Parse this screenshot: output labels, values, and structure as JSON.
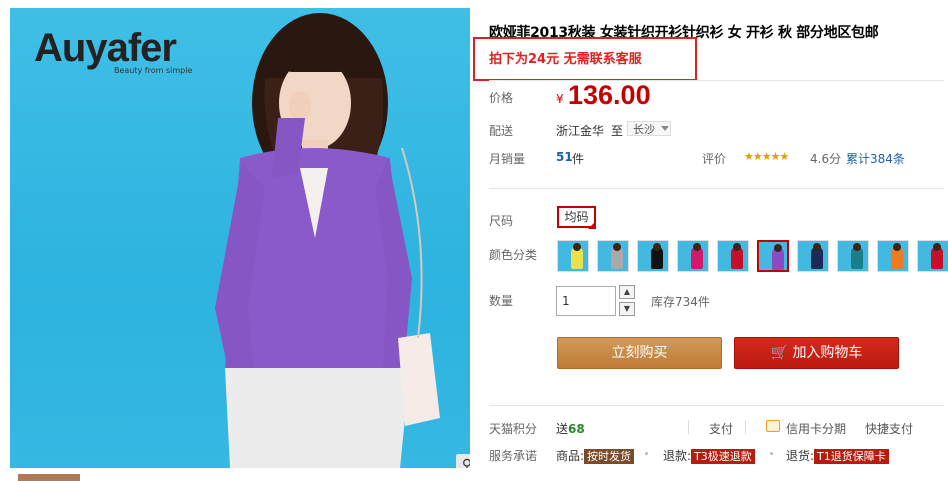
{
  "image": {
    "brand": "Auyafer",
    "brand_sub": "Beauty from simple",
    "zoom_icon": "search-icon"
  },
  "product": {
    "title": "欧娅菲2013秋装 女装针织开衫针织衫 女 开衫 秋 部分地区包邮",
    "promo": "拍下为24元 无需联系客服",
    "price_label": "价格",
    "currency": "¥",
    "price": "136.00",
    "shipping_label": "配送",
    "ship_from": "浙江金华",
    "ship_to_word": "至",
    "ship_city": "长沙",
    "sales_label": "月销量",
    "sales_count": "51",
    "sales_unit": "件",
    "rating_label": "评价",
    "rating_stars": "★★★★★",
    "rating_value": "4.6分",
    "review_count": "累计384条",
    "size_label": "尺码",
    "size_value": "均码",
    "color_label": "颜色分类",
    "color_swatches": [
      "#e9e24a",
      "#a9a9a9",
      "#111111",
      "#d11a6a",
      "#c6102a",
      "#8a4bc7",
      "#1c2a5a",
      "#1a7f86",
      "#ee7a22",
      "#c6102a"
    ],
    "selected_swatch": 5,
    "qty_label": "数量",
    "qty_value": "1",
    "stock": "库存734件",
    "buy_label": "立刻购买",
    "cart_label": "加入购物车",
    "points_label": "天猫积分",
    "points_prefix": "送",
    "points_value": "68",
    "pay_label": "支付",
    "credit_label": "信用卡分期",
    "quickpay_label": "快捷支付",
    "service_label": "服务承诺",
    "svc_goods": "商品:",
    "svc_goods_tag": "按时发货",
    "svc_refund": "退款:",
    "svc_refund_tag": "T3极速退款",
    "svc_return": "退货:",
    "svc_return_tag": "T1退货保障卡"
  },
  "colors": {
    "accent_red": "#c40000",
    "buy_orange": "#c98a46",
    "cart_red": "#c8241a"
  }
}
